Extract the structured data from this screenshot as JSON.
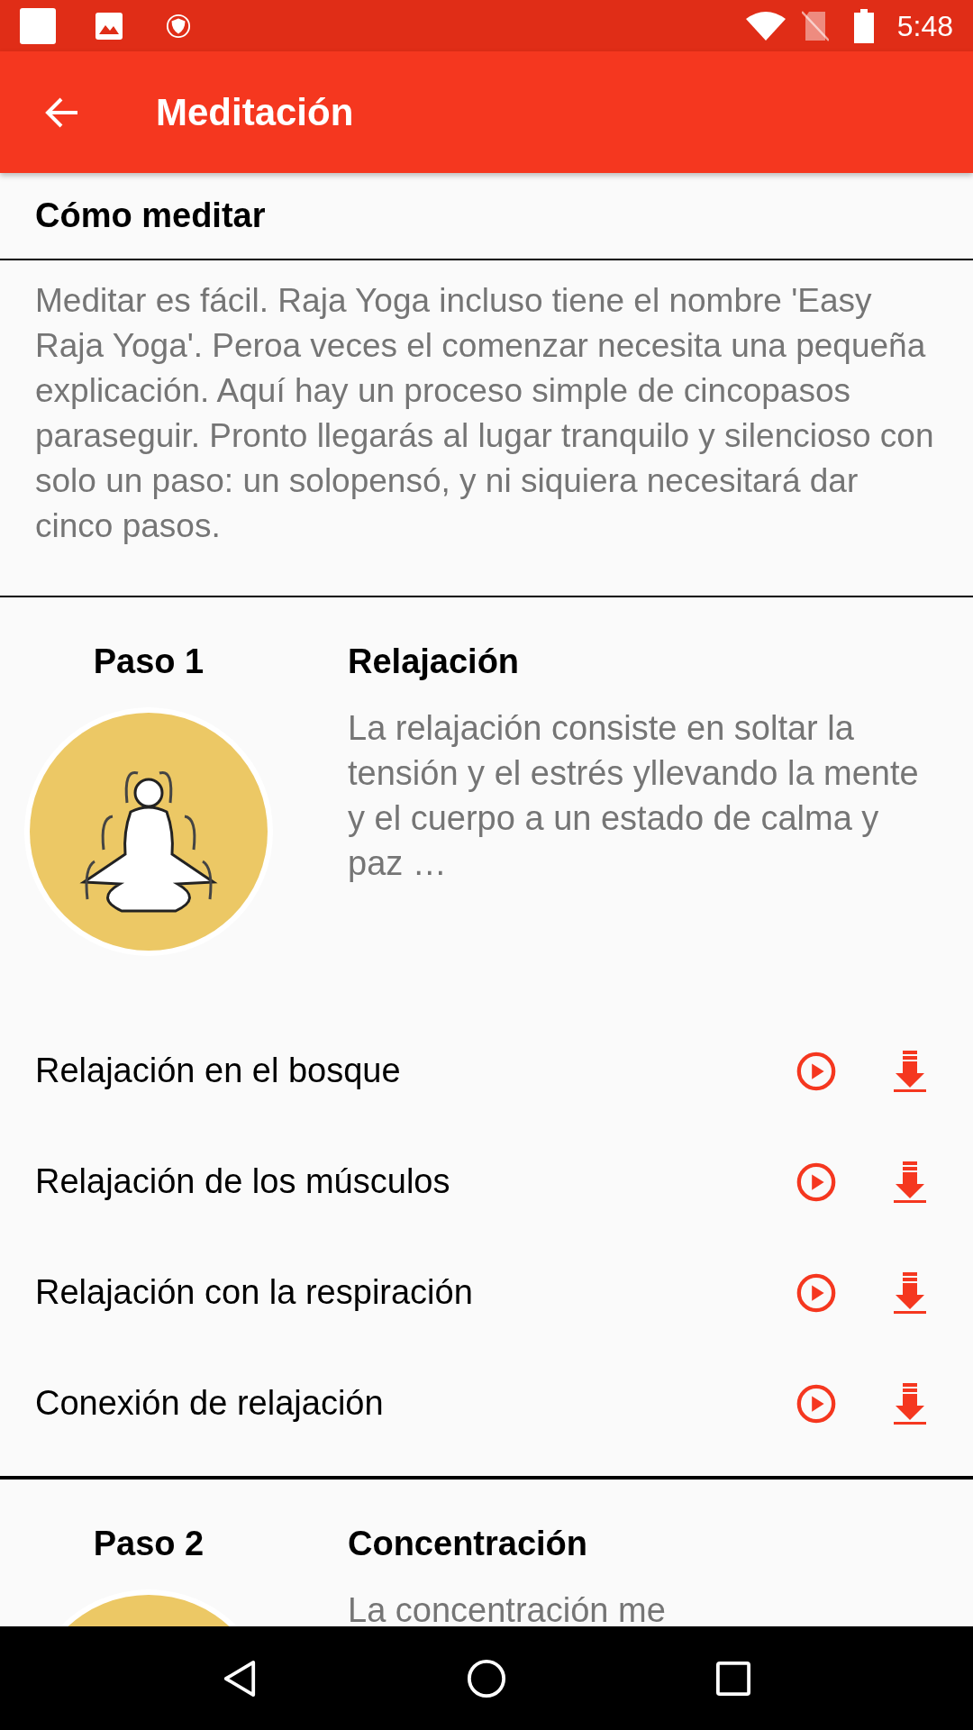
{
  "status_bar": {
    "time": "5:48"
  },
  "app_bar": {
    "title": "Meditación"
  },
  "section": {
    "title": "Cómo meditar",
    "intro": "Meditar es fácil. Raja Yoga incluso tiene el nombre 'Easy Raja Yoga'. Peroa veces el comenzar necesita una pequeña explicación. Aquí hay un proceso simple de cincopasos paraseguir. Pronto llegarás al lugar tranquilo y silencioso con solo un paso: un solopensó, y ni siquiera necesitará dar cinco pasos."
  },
  "steps": [
    {
      "label": "Paso 1",
      "title": "Relajación",
      "description": "La relajación consiste en soltar la tensión y el estrés yllevando la mente y el cuerpo a un estado de calma y paz …",
      "tracks": [
        {
          "title": "Relajación en el bosque"
        },
        {
          "title": "Relajación de los músculos"
        },
        {
          "title": "Relajación con la respiración"
        },
        {
          "title": "Conexión de relajación"
        }
      ]
    },
    {
      "label": "Paso 2",
      "title": "Concentración",
      "description": "La concentración me"
    }
  ]
}
